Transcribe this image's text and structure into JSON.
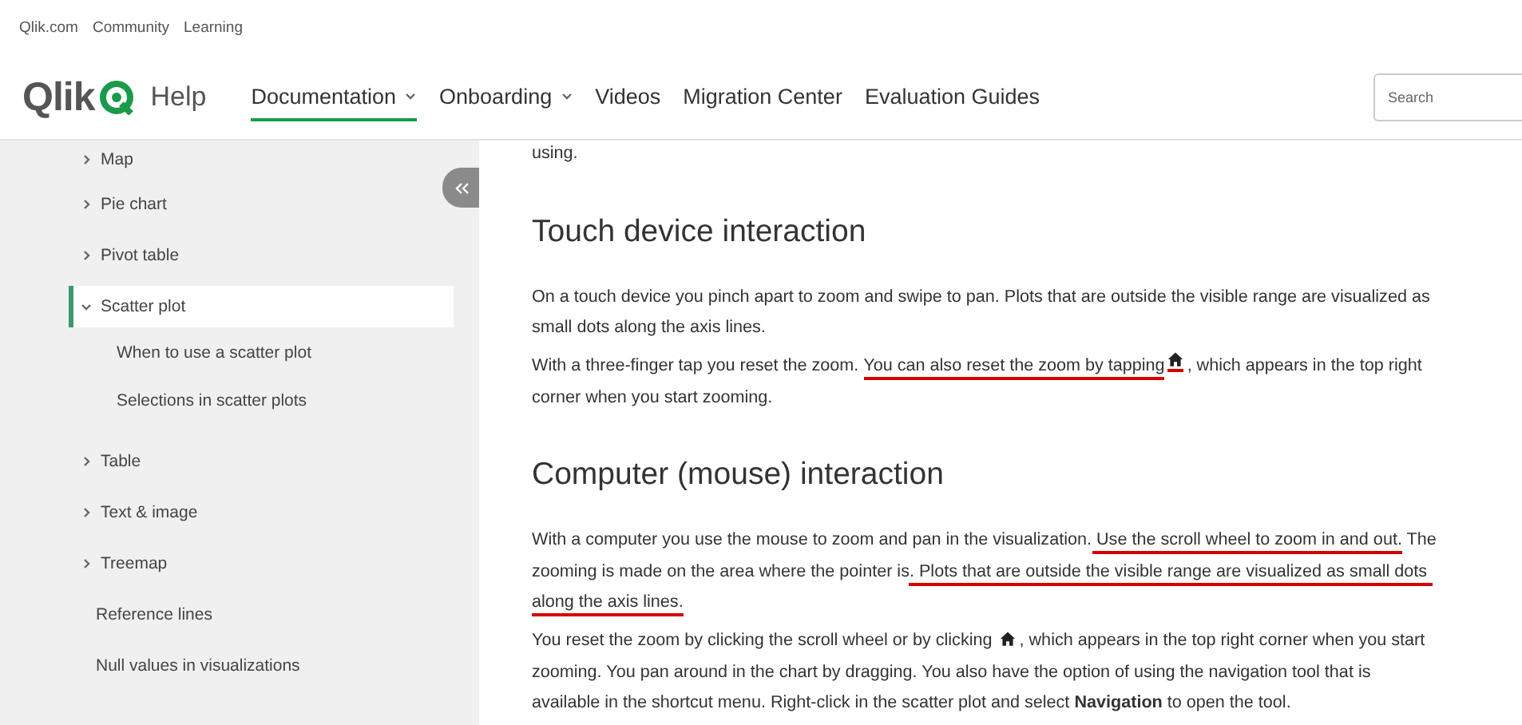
{
  "top_links": [
    "Qlik.com",
    "Community",
    "Learning"
  ],
  "header": {
    "brand": "Qlik",
    "title": "Help",
    "nav": [
      {
        "label": "Documentation",
        "has_menu": true,
        "selected": true
      },
      {
        "label": "Onboarding",
        "has_menu": true,
        "selected": false
      },
      {
        "label": "Videos",
        "has_menu": false,
        "selected": false
      },
      {
        "label": "Migration Center",
        "has_menu": false,
        "selected": false
      },
      {
        "label": "Evaluation Guides",
        "has_menu": false,
        "selected": false
      }
    ],
    "search": {
      "placeholder": "Search"
    }
  },
  "sidebar": {
    "items": [
      {
        "label": "Map",
        "kind": "branch",
        "expanded": false,
        "selected": false
      },
      {
        "label": "Pie chart",
        "kind": "branch",
        "expanded": false,
        "selected": false
      },
      {
        "label": "Pivot table",
        "kind": "branch",
        "expanded": false,
        "selected": false
      },
      {
        "label": "Scatter plot",
        "kind": "branch",
        "expanded": true,
        "selected": true,
        "children": [
          {
            "label": "When to use a scatter plot",
            "kind": "leaf",
            "selected": false
          },
          {
            "label": "Selections in scatter plots",
            "kind": "leaf",
            "selected": false
          }
        ]
      },
      {
        "label": "Table",
        "kind": "branch",
        "expanded": false,
        "selected": false
      },
      {
        "label": "Text & image",
        "kind": "branch",
        "expanded": false,
        "selected": false
      },
      {
        "label": "Treemap",
        "kind": "branch",
        "expanded": false,
        "selected": false
      },
      {
        "label": "Reference lines",
        "kind": "leaf",
        "selected": false
      },
      {
        "label": "Null values in visualizations",
        "kind": "leaf",
        "selected": false
      }
    ]
  },
  "article": {
    "blocks": [
      {
        "kind": "paragraph",
        "segments": [
          {
            "text": "using.",
            "underlined": false
          }
        ]
      },
      {
        "kind": "heading",
        "text": "Touch device interaction"
      },
      {
        "kind": "paragraph",
        "segments": [
          {
            "text": "On a touch device you pinch apart to zoom and swipe to pan. Plots that are outside the visible range are visualized as ",
            "underlined": false
          },
          {
            "text": "small dots along the axis lines.",
            "underlined": false
          }
        ]
      },
      {
        "kind": "paragraph",
        "segments": [
          {
            "text": "With a three-finger tap you reset the zoom. ",
            "underlined": false
          },
          {
            "text": "You can also reset the zoom by tapping",
            "underlined": true
          },
          {
            "kind": "icon",
            "underlined": true
          },
          {
            "text": ", which appears in the top right ",
            "underlined": false
          },
          {
            "text": "corner when you start zooming.",
            "underlined": false
          }
        ]
      },
      {
        "kind": "heading",
        "text": "Computer (mouse) interaction"
      },
      {
        "kind": "paragraph",
        "segments": [
          {
            "text": "With a computer you use the mouse to zoom and pan in the visualization.",
            "underlined": false
          },
          {
            "text": " Use the scroll wheel to zoom in and out.",
            "underlined": true
          },
          {
            "text": " The ",
            "underlined": false
          },
          {
            "text": "zooming is made on the area where the pointer is",
            "underlined": false
          },
          {
            "text": ". Plots that are outside the visible range are visualized as small dots ",
            "underlined": true
          },
          {
            "text": "along the axis lines.",
            "underlined": true
          }
        ]
      },
      {
        "kind": "paragraph",
        "segments": [
          {
            "text": "You reset the zoom by clicking the scroll wheel or by clicking ",
            "underlined": false
          },
          {
            "kind": "icon",
            "underlined": false
          },
          {
            "text": ", which appears in the top right corner when you start ",
            "underlined": false
          },
          {
            "text": "zooming. You pan around in the chart by dragging. You also have the option of using the navigation tool that is ",
            "underlined": false
          },
          {
            "text": "available in the shortcut menu. Right-click in the scatter plot and select **Navigation** to open the tool.",
            "underlined": false
          }
        ]
      }
    ]
  }
}
